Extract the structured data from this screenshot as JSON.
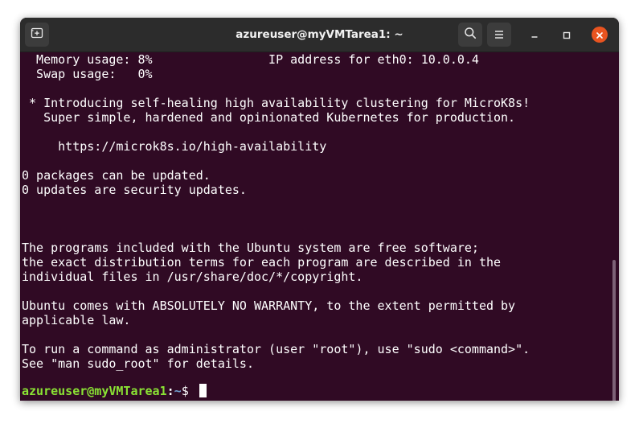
{
  "window": {
    "title": "azureuser@myVMTarea1: ~"
  },
  "icons": {
    "new_tab": "new-tab-icon",
    "search": "search-icon",
    "menu": "hamburger-menu-icon",
    "minimize": "minimize-icon",
    "maximize": "maximize-icon",
    "close": "close-icon"
  },
  "colors": {
    "terminal_bg": "#300a24",
    "titlebar_bg": "#2c2c2c",
    "close_button": "#e95420",
    "prompt_user": "#8ae234",
    "prompt_path": "#729fcf"
  },
  "terminal": {
    "lines": [
      "  Memory usage: 8%                IP address for eth0: 10.0.0.4",
      "  Swap usage:   0%",
      "",
      " * Introducing self-healing high availability clustering for MicroK8s!",
      "   Super simple, hardened and opinionated Kubernetes for production.",
      "",
      "     https://microk8s.io/high-availability",
      "",
      "0 packages can be updated.",
      "0 updates are security updates.",
      "",
      "",
      "",
      "The programs included with the Ubuntu system are free software;",
      "the exact distribution terms for each program are described in the",
      "individual files in /usr/share/doc/*/copyright.",
      "",
      "Ubuntu comes with ABSOLUTELY NO WARRANTY, to the extent permitted by",
      "applicable law.",
      "",
      "To run a command as administrator (user \"root\"), use \"sudo <command>\".",
      "See \"man sudo_root\" for details."
    ],
    "prompt": {
      "user_host": "azureuser@myVMTarea1",
      "separator": ":",
      "path": "~",
      "symbol": "$ "
    }
  }
}
